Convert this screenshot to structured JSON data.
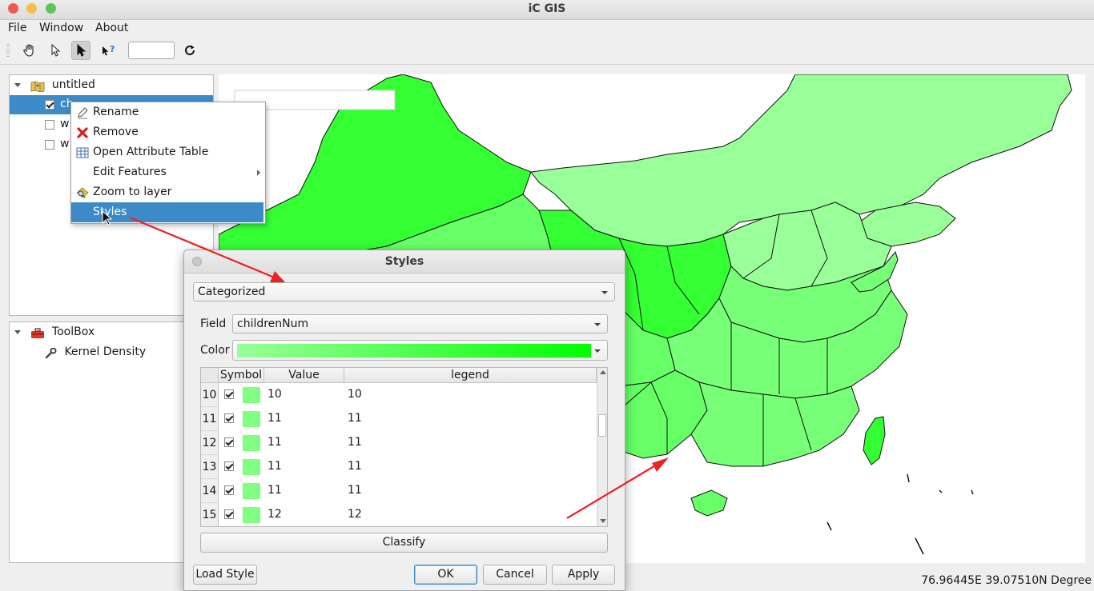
{
  "window": {
    "title": "iC GIS",
    "traffic_lights": [
      "#ee5a52",
      "#f4be4f",
      "#5ec454"
    ]
  },
  "menubar": {
    "items": [
      "File",
      "Window",
      "About"
    ]
  },
  "toolbar": {
    "tools": [
      "pan-hand-icon",
      "select-arrow-icon",
      "identify-arrow-icon",
      "whats-this-icon"
    ],
    "active_tool": "identify-arrow-icon",
    "scale_value": "",
    "refresh_icon": "refresh-icon"
  },
  "layers": {
    "root": "untitled",
    "items": [
      {
        "label": "ch",
        "checked": true
      },
      {
        "label": "w",
        "checked": false
      },
      {
        "label": "w",
        "checked": false
      }
    ]
  },
  "toolbox": {
    "title": "ToolBox",
    "items": [
      "Kernel Density"
    ]
  },
  "context_menu": {
    "items": [
      {
        "label": "Rename",
        "icon": "pencil-icon"
      },
      {
        "label": "Remove",
        "icon": "red-x-icon"
      },
      {
        "label": "Open Attribute Table",
        "icon": "table-icon"
      },
      {
        "label": "Edit Features",
        "icon": "",
        "submenu": true
      },
      {
        "label": "Zoom to layer",
        "icon": "zoom-layer-icon"
      },
      {
        "label": "Styles",
        "icon": "",
        "highlighted": true
      }
    ]
  },
  "styles_dialog": {
    "title": "Styles",
    "renderer": "Categorized",
    "field_label": "Field",
    "field_value": "childrenNum",
    "color_label": "Color",
    "color_ramp": [
      "#99ff99",
      "#00ff00"
    ],
    "columns": [
      "Symbol",
      "Value",
      "legend"
    ],
    "rows": [
      {
        "index": "10",
        "checked": true,
        "color": "#80ff80",
        "value": "10",
        "legend": "10"
      },
      {
        "index": "11",
        "checked": true,
        "color": "#80ff80",
        "value": "11",
        "legend": "11"
      },
      {
        "index": "12",
        "checked": true,
        "color": "#80ff80",
        "value": "11",
        "legend": "11"
      },
      {
        "index": "13",
        "checked": true,
        "color": "#80ff80",
        "value": "11",
        "legend": "11"
      },
      {
        "index": "14",
        "checked": true,
        "color": "#80ff80",
        "value": "11",
        "legend": "11"
      },
      {
        "index": "15",
        "checked": true,
        "color": "#80ff80",
        "value": "12",
        "legend": "12"
      }
    ],
    "classify_label": "Classify",
    "load_style_label": "Load Style",
    "ok_label": "OK",
    "cancel_label": "Cancel",
    "apply_label": "Apply"
  },
  "map": {
    "fill_colors": [
      "#33ff33",
      "#66ff66",
      "#77ff77",
      "#99ff99"
    ]
  },
  "statusbar": {
    "coordinates": "76.96445E 39.07510N  Degree"
  }
}
